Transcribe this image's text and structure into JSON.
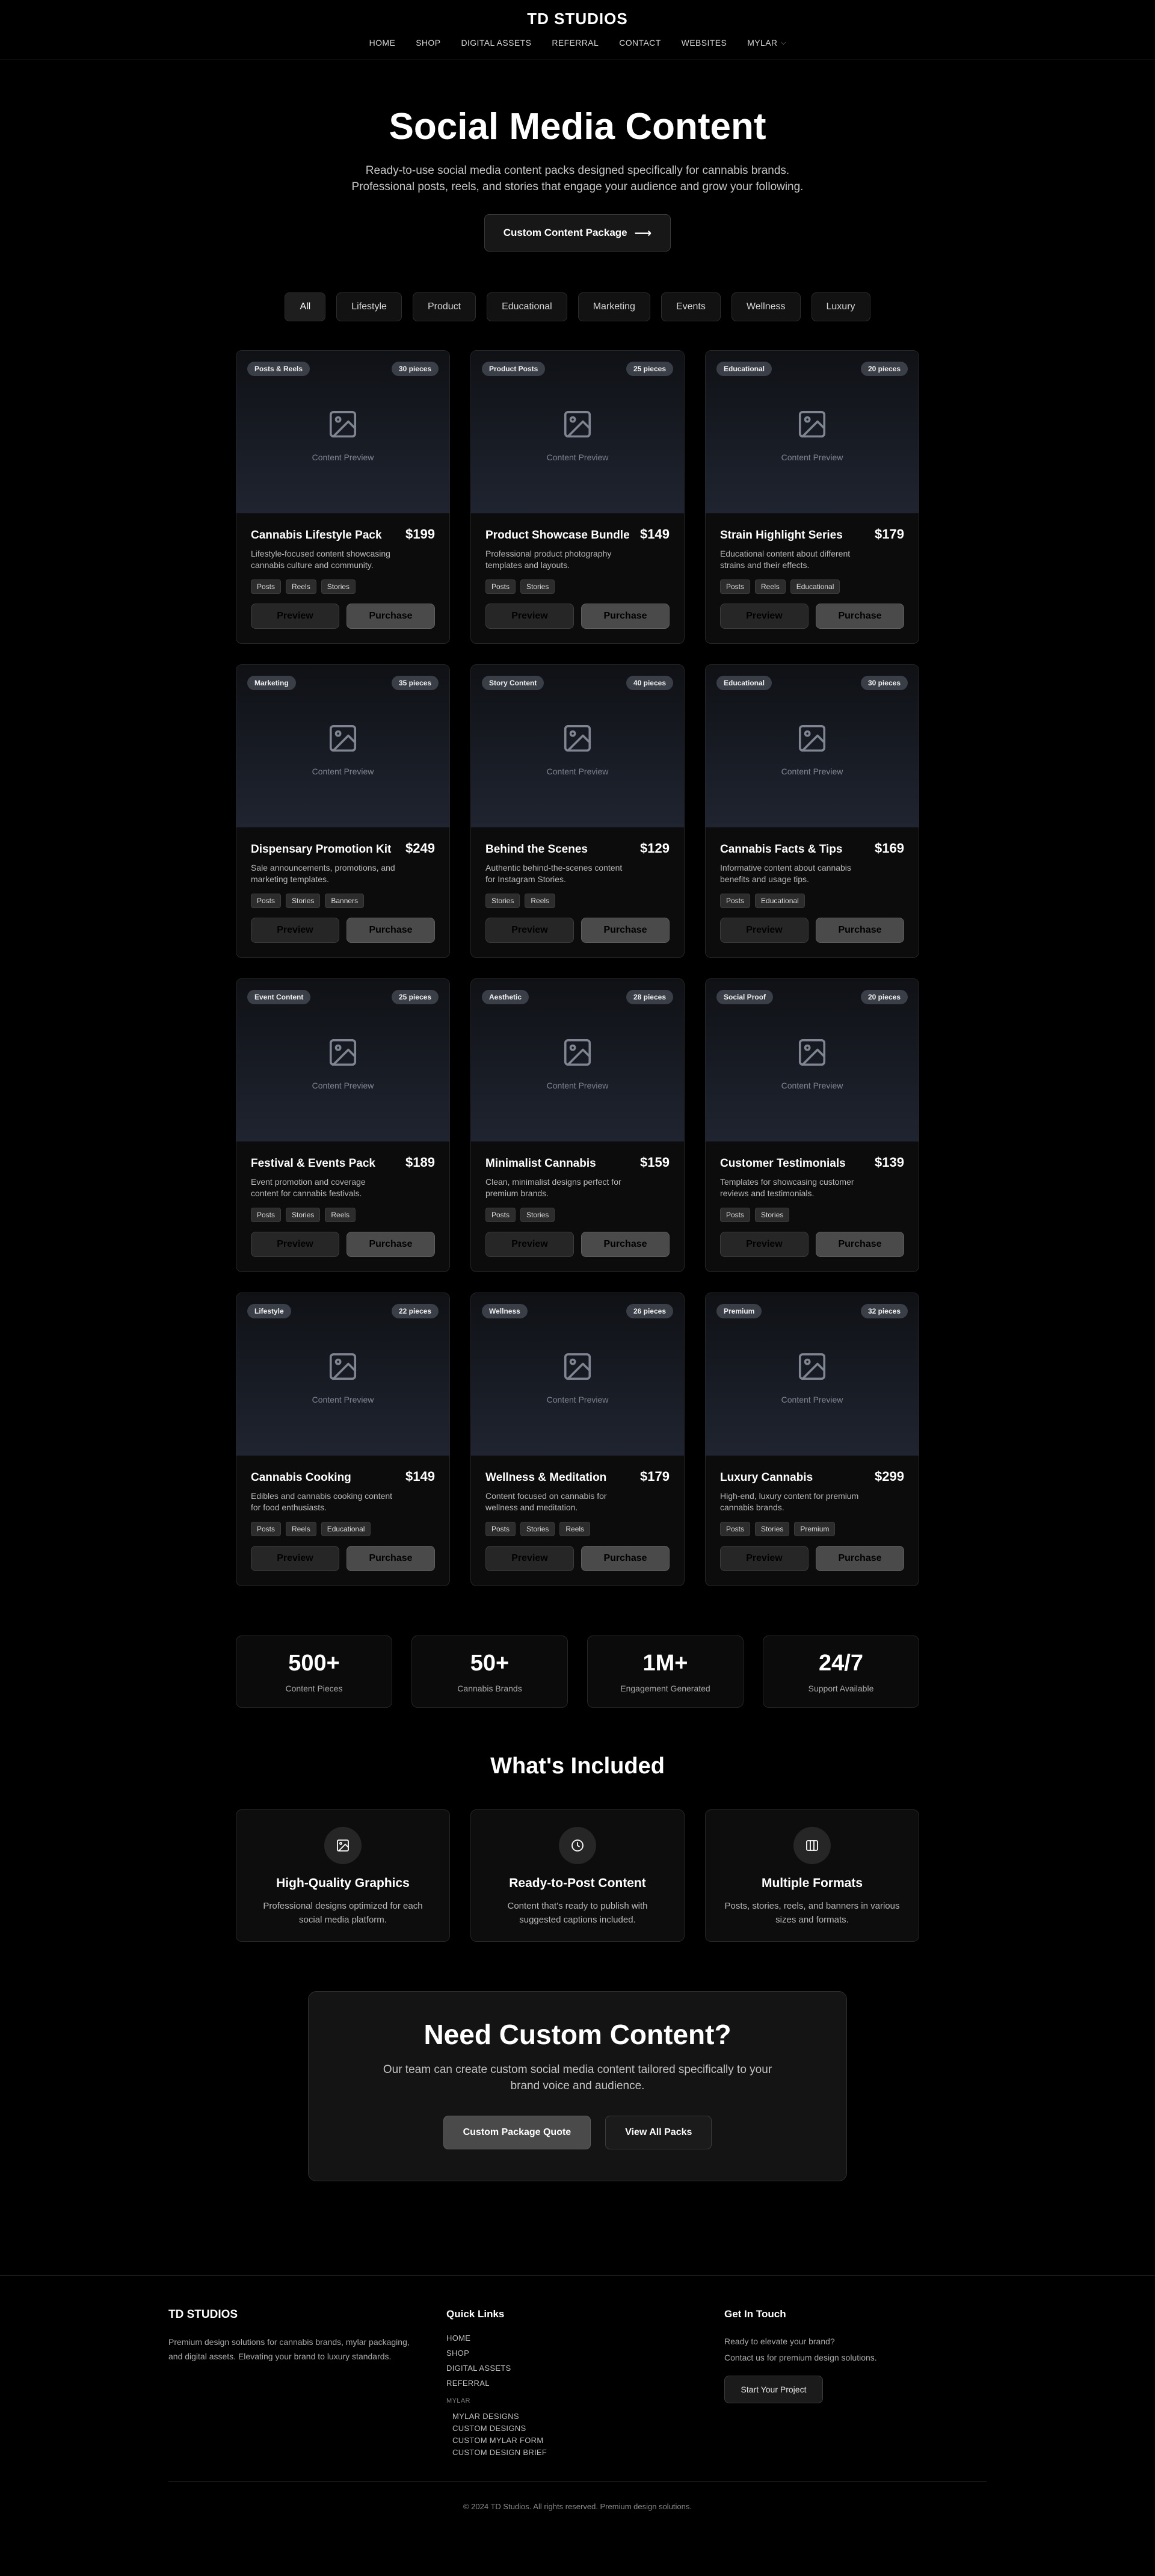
{
  "header": {
    "brand": "TD STUDIOS",
    "nav": [
      "HOME",
      "SHOP",
      "DIGITAL ASSETS",
      "REFERRAL",
      "CONTACT",
      "WEBSITES",
      "MYLAR"
    ]
  },
  "hero": {
    "title": "Social Media Content",
    "subtitle": "Ready-to-use social media content packs designed specifically for cannabis brands. Professional posts, reels, and stories that engage your audience and grow your following.",
    "cta_label": "Custom Content Package",
    "cta_arrow": "⟶"
  },
  "filters": [
    "All",
    "Lifestyle",
    "Product",
    "Educational",
    "Marketing",
    "Events",
    "Wellness",
    "Luxury"
  ],
  "card_common": {
    "preview_label": "Content Preview",
    "preview_button": "Preview",
    "purchase_button": "Purchase"
  },
  "products": [
    {
      "category": "Posts & Reels",
      "count": "30 pieces",
      "title": "Cannabis Lifestyle Pack",
      "price": "$199",
      "desc": "Lifestyle-focused content showcasing cannabis culture and community.",
      "tags": [
        "Posts",
        "Reels",
        "Stories"
      ]
    },
    {
      "category": "Product Posts",
      "count": "25 pieces",
      "title": "Product Showcase Bundle",
      "price": "$149",
      "desc": "Professional product photography templates and layouts.",
      "tags": [
        "Posts",
        "Stories"
      ]
    },
    {
      "category": "Educational",
      "count": "20 pieces",
      "title": "Strain Highlight Series",
      "price": "$179",
      "desc": "Educational content about different strains and their effects.",
      "tags": [
        "Posts",
        "Reels",
        "Educational"
      ]
    },
    {
      "category": "Marketing",
      "count": "35 pieces",
      "title": "Dispensary Promotion Kit",
      "price": "$249",
      "desc": "Sale announcements, promotions, and marketing templates.",
      "tags": [
        "Posts",
        "Stories",
        "Banners"
      ]
    },
    {
      "category": "Story Content",
      "count": "40 pieces",
      "title": "Behind the Scenes",
      "price": "$129",
      "desc": "Authentic behind-the-scenes content for Instagram Stories.",
      "tags": [
        "Stories",
        "Reels"
      ]
    },
    {
      "category": "Educational",
      "count": "30 pieces",
      "title": "Cannabis Facts & Tips",
      "price": "$169",
      "desc": "Informative content about cannabis benefits and usage tips.",
      "tags": [
        "Posts",
        "Educational"
      ]
    },
    {
      "category": "Event Content",
      "count": "25 pieces",
      "title": "Festival & Events Pack",
      "price": "$189",
      "desc": "Event promotion and coverage content for cannabis festivals.",
      "tags": [
        "Posts",
        "Stories",
        "Reels"
      ]
    },
    {
      "category": "Aesthetic",
      "count": "28 pieces",
      "title": "Minimalist Cannabis",
      "price": "$159",
      "desc": "Clean, minimalist designs perfect for premium brands.",
      "tags": [
        "Posts",
        "Stories"
      ]
    },
    {
      "category": "Social Proof",
      "count": "20 pieces",
      "title": "Customer Testimonials",
      "price": "$139",
      "desc": "Templates for showcasing customer reviews and testimonials.",
      "tags": [
        "Posts",
        "Stories"
      ]
    },
    {
      "category": "Lifestyle",
      "count": "22 pieces",
      "title": "Cannabis Cooking",
      "price": "$149",
      "desc": "Edibles and cannabis cooking content for food enthusiasts.",
      "tags": [
        "Posts",
        "Reels",
        "Educational"
      ]
    },
    {
      "category": "Wellness",
      "count": "26 pieces",
      "title": "Wellness & Meditation",
      "price": "$179",
      "desc": "Content focused on cannabis for wellness and meditation.",
      "tags": [
        "Posts",
        "Stories",
        "Reels"
      ]
    },
    {
      "category": "Premium",
      "count": "32 pieces",
      "title": "Luxury Cannabis",
      "price": "$299",
      "desc": "High-end, luxury content for premium cannabis brands.",
      "tags": [
        "Posts",
        "Stories",
        "Premium"
      ]
    }
  ],
  "stats": [
    {
      "value": "500+",
      "label": "Content Pieces"
    },
    {
      "value": "50+",
      "label": "Cannabis Brands"
    },
    {
      "value": "1M+",
      "label": "Engagement Generated"
    },
    {
      "value": "24/7",
      "label": "Support Available"
    }
  ],
  "included": {
    "title": "What's Included",
    "items": [
      {
        "icon": "image-icon",
        "title": "High-Quality Graphics",
        "desc": "Professional designs optimized for each social media platform."
      },
      {
        "icon": "clock-icon",
        "title": "Ready-to-Post Content",
        "desc": "Content that's ready to publish with suggested captions included."
      },
      {
        "icon": "columns-icon",
        "title": "Multiple Formats",
        "desc": "Posts, stories, reels, and banners in various sizes and formats."
      }
    ]
  },
  "cta": {
    "title": "Need Custom Content?",
    "subtitle": "Our team can create custom social media content tailored specifically to your brand voice and audience.",
    "primary": "Custom Package Quote",
    "secondary": "View All Packs"
  },
  "footer": {
    "brand": "TD STUDIOS",
    "about": "Premium design solutions for cannabis brands, mylar packaging, and digital assets. Elevating your brand to luxury standards.",
    "quick_links_title": "Quick Links",
    "quick_links": [
      "HOME",
      "SHOP",
      "DIGITAL ASSETS",
      "REFERRAL"
    ],
    "mylar_heading": "MYLAR",
    "mylar_links": [
      "MYLAR DESIGNS",
      "CUSTOM DESIGNS",
      "CUSTOM MYLAR FORM",
      "CUSTOM DESIGN BRIEF"
    ],
    "touch_title": "Get In Touch",
    "touch_line1": "Ready to elevate your brand?",
    "touch_line2": "Contact us for premium design solutions.",
    "touch_button": "Start Your Project",
    "copyright": "© 2024 TD Studios. All rights reserved. Premium design solutions."
  }
}
